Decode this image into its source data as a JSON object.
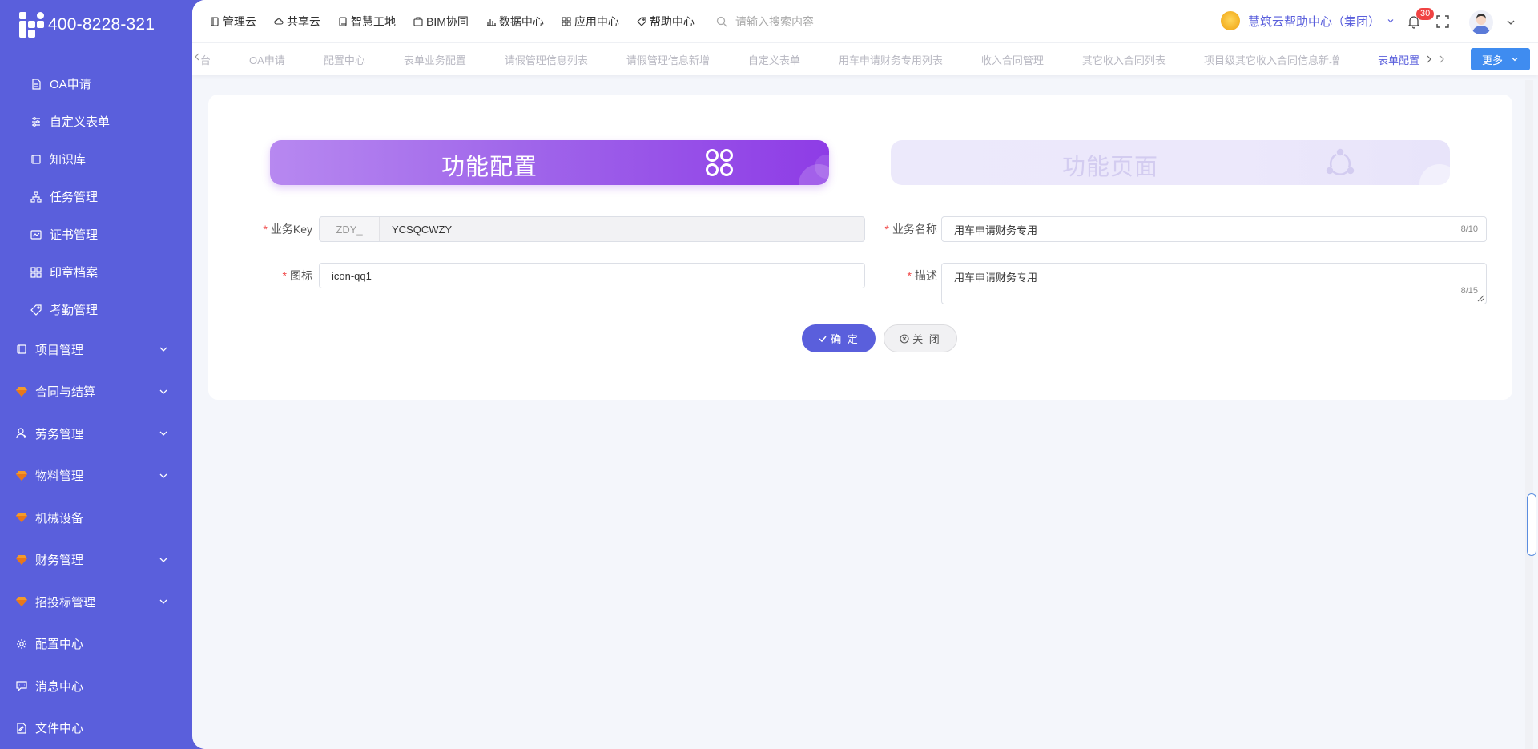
{
  "sidebar": {
    "logo_text": "400-8228-321",
    "items": [
      {
        "label": "OA申请",
        "icon": "document-icon"
      },
      {
        "label": "自定义表单",
        "icon": "form-icon"
      },
      {
        "label": "知识库",
        "icon": "book-icon"
      },
      {
        "label": "任务管理",
        "icon": "hierarchy-icon"
      },
      {
        "label": "证书管理",
        "icon": "certificate-icon"
      },
      {
        "label": "印章档案",
        "icon": "grid-icon"
      },
      {
        "label": "考勤管理",
        "icon": "tag-icon"
      }
    ],
    "groups": [
      {
        "label": "项目管理",
        "icon": "book-icon",
        "expandable": true
      },
      {
        "label": "合同与结算",
        "icon": "gem-icon",
        "expandable": true
      },
      {
        "label": "劳务管理",
        "icon": "user-icon",
        "expandable": true
      },
      {
        "label": "物料管理",
        "icon": "gem-icon",
        "expandable": true
      },
      {
        "label": "机械设备",
        "icon": "gem-icon",
        "expandable": false
      },
      {
        "label": "财务管理",
        "icon": "gem-icon",
        "expandable": true
      },
      {
        "label": "招投标管理",
        "icon": "gem-icon",
        "expandable": true
      },
      {
        "label": "配置中心",
        "icon": "gear-icon",
        "expandable": false
      },
      {
        "label": "消息中心",
        "icon": "message-icon",
        "expandable": false
      },
      {
        "label": "文件中心",
        "icon": "file-edit-icon",
        "expandable": false
      }
    ]
  },
  "topnav": {
    "items": [
      "管理云",
      "共享云",
      "智慧工地",
      "BIM协同",
      "数据中心",
      "应用中心",
      "帮助中心"
    ],
    "search_placeholder": "请输入搜索内容",
    "help_center": "慧筑云帮助中心（集团）",
    "notification_count": "30"
  },
  "tabs": {
    "items": [
      "台",
      "OA申请",
      "配置中心",
      "表单业务配置",
      "请假管理信息列表",
      "请假管理信息新增",
      "自定义表单",
      "用车申请财务专用列表",
      "收入合同管理",
      "其它收入合同列表",
      "项目级其它收入合同信息新增",
      "表单配置"
    ],
    "active_index": 11,
    "more_label": "更多"
  },
  "banners": {
    "config_title": "功能配置",
    "page_title": "功能页面"
  },
  "form": {
    "key_label": "业务Key",
    "key_prefix": "ZDY_",
    "key_value": "YCSQCWZY",
    "name_label": "业务名称",
    "name_value": "用车申请财务专用",
    "name_counter": "8/10",
    "icon_label": "图标",
    "icon_value": "icon-qq1",
    "desc_label": "描述",
    "desc_value": "用车申请财务专用",
    "desc_counter": "8/15",
    "required_mark": "*"
  },
  "buttons": {
    "confirm": "确 定",
    "close": "关 闭"
  },
  "colors": {
    "sidebar": "#5a5fdc",
    "accent": "#5a5fdc",
    "more_button": "#3f8cf0",
    "badge": "#f04343"
  }
}
